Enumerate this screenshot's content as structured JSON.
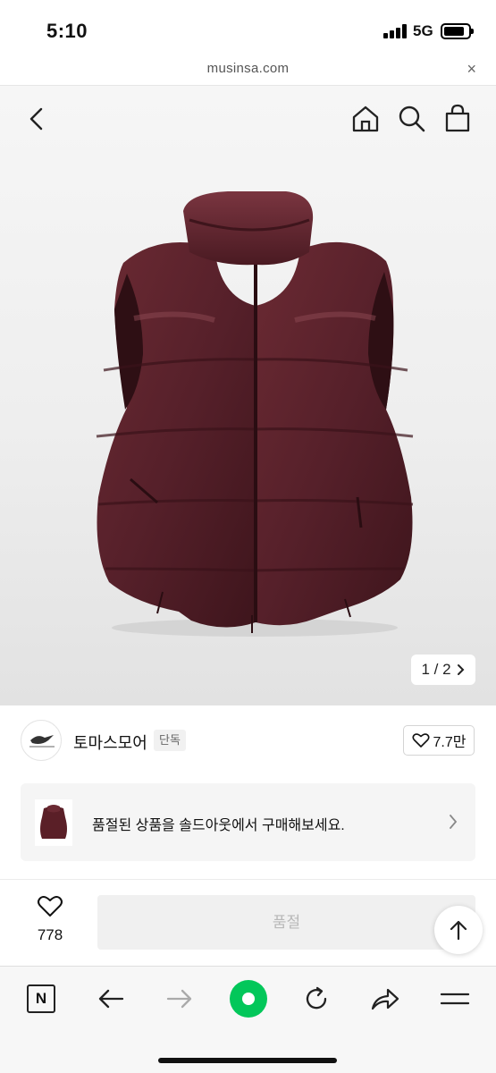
{
  "status_bar": {
    "time": "5:10",
    "network": "5G"
  },
  "url_bar": {
    "domain": "musinsa.com",
    "close": "×"
  },
  "product": {
    "image_counter": "1 / 2",
    "image_color": "#5a1f27"
  },
  "brand": {
    "name": "토마스모어",
    "tag": "단독",
    "likes": "7.7만"
  },
  "soldout_banner": {
    "text": "품절된 상품을 솔드아웃에서 구매해보세요."
  },
  "action_bar": {
    "wish_count": "778",
    "soldout_label": "품절"
  },
  "browser_toolbar": {
    "naver_label": "N",
    "accent_color": "#03c75a"
  },
  "icons": [
    "back-icon",
    "home-icon",
    "search-icon",
    "shopping-bag-icon",
    "chevron-right-icon",
    "heart-icon",
    "arrow-up-icon",
    "arrow-left-icon",
    "arrow-right-icon",
    "refresh-icon",
    "share-icon",
    "menu-icon"
  ]
}
